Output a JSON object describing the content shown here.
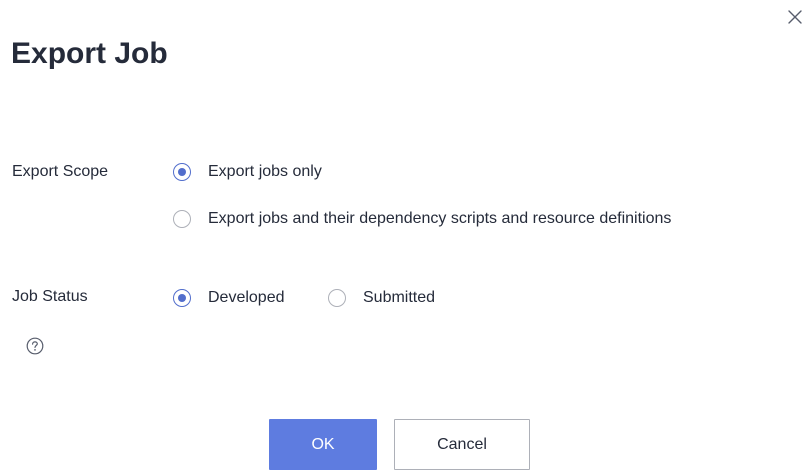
{
  "dialog": {
    "title": "Export Job",
    "close_icon": "close-icon"
  },
  "export_scope": {
    "label": "Export Scope",
    "options": [
      {
        "label": "Export jobs only",
        "selected": true
      },
      {
        "label": "Export jobs and their dependency scripts and resource definitions",
        "selected": false
      }
    ]
  },
  "job_status": {
    "label": "Job Status",
    "help_icon": "question-circle-icon",
    "options": [
      {
        "label": "Developed",
        "selected": true
      },
      {
        "label": "Submitted",
        "selected": false
      }
    ]
  },
  "footer": {
    "ok_label": "OK",
    "cancel_label": "Cancel"
  },
  "colors": {
    "primary": "#5e7ce0",
    "radio_checked": "#526ecc",
    "text": "#252b3a",
    "border": "#adb0b8"
  }
}
